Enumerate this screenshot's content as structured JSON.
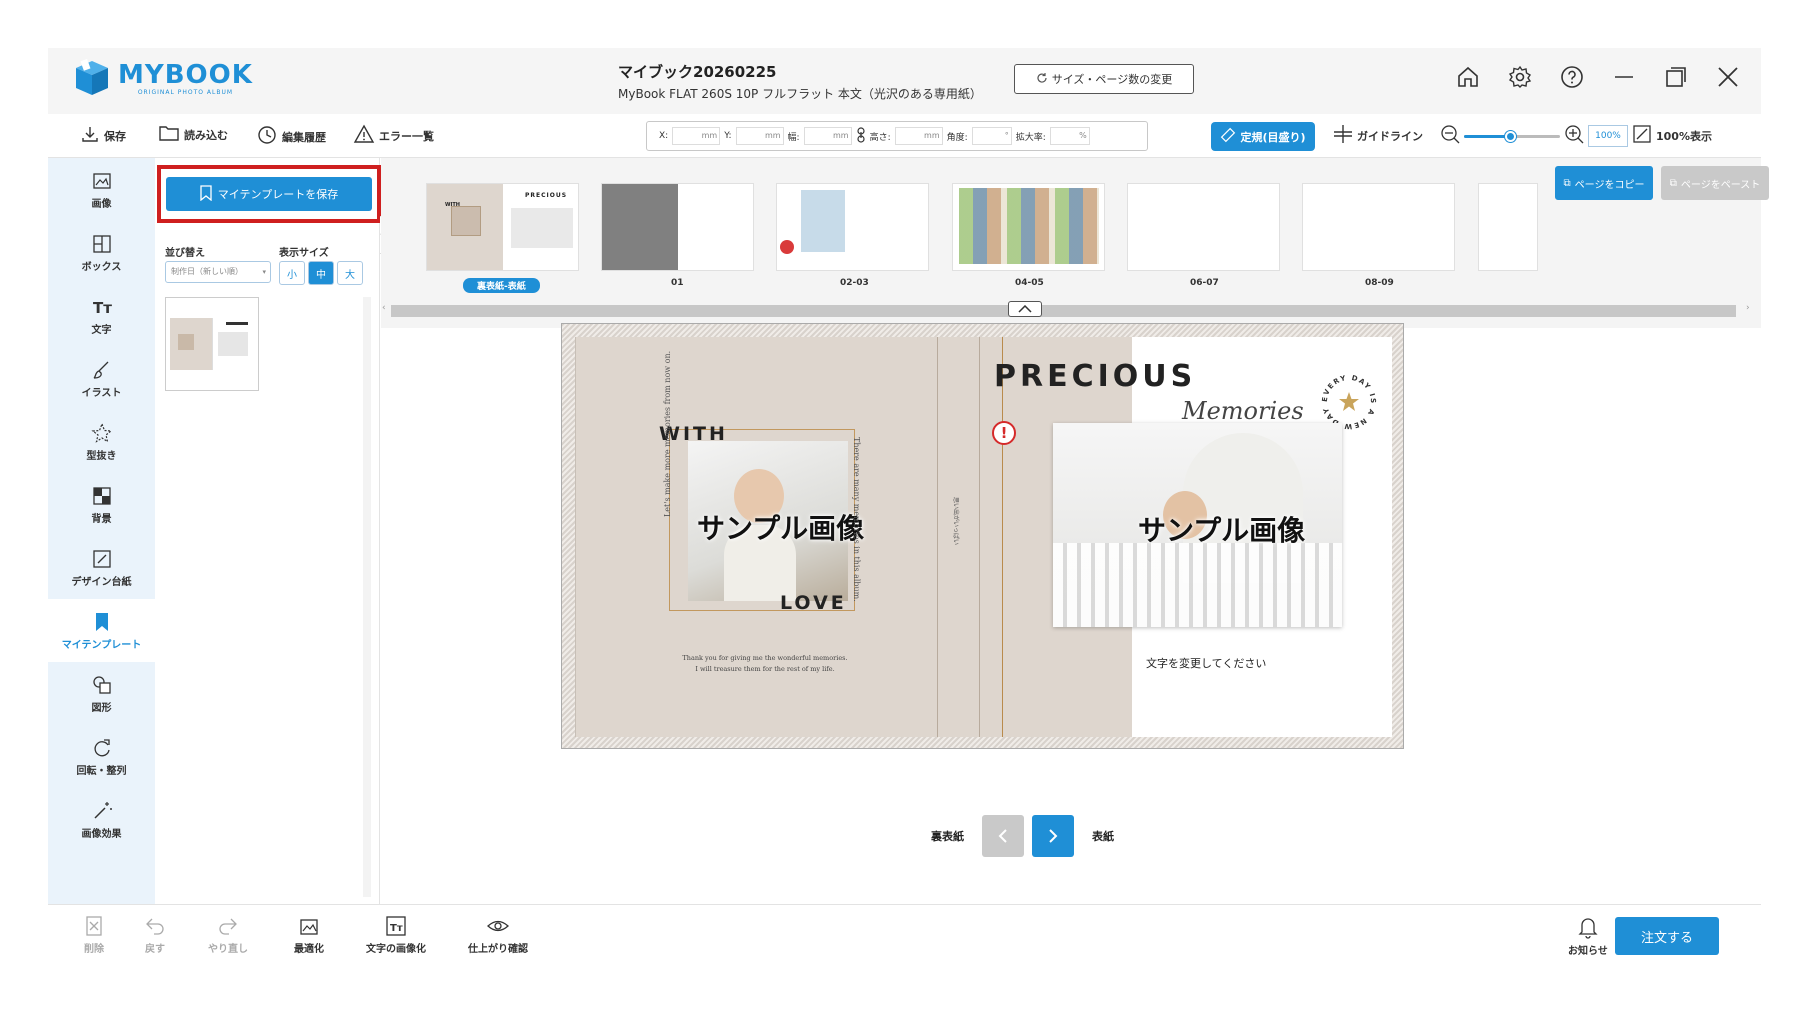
{
  "app": {
    "logo_text": "MYBOOK",
    "logo_sub": "ORIGINAL PHOTO ALBUM",
    "doc_title": "マイブック20260225",
    "doc_subtitle": "MyBook FLAT 260S 10P フルフラット 本文（光沢のある専用紙）",
    "size_change_label": "サイズ・ページ数の変更"
  },
  "window_icons": [
    "home-icon",
    "gear-icon",
    "help-icon",
    "minimize-icon",
    "restore-icon",
    "close-icon"
  ],
  "toolbar": {
    "save_label": "保存",
    "load_label": "読み込む",
    "history_label": "編集履歴",
    "errors_label": "エラー一覧",
    "x_label": "X:",
    "y_label": "Y:",
    "width_label": "幅:",
    "height_label": "高さ:",
    "angle_label": "角度:",
    "zoom_label": "拡大率:",
    "mm_unit": "mm",
    "deg_unit": "°",
    "pct_unit": "%",
    "ruler_label": "定規(目盛り)",
    "guideline_label": "ガイドライン",
    "zoom_value": "100%",
    "zoom_slider_value": 0.5,
    "fit_label": "100%表示"
  },
  "sidebar": {
    "items": [
      {
        "label": "画像",
        "icon": "image-icon"
      },
      {
        "label": "ボックス",
        "icon": "box-icon"
      },
      {
        "label": "文字",
        "icon": "text-icon"
      },
      {
        "label": "イラスト",
        "icon": "brush-icon"
      },
      {
        "label": "型抜き",
        "icon": "star-cutout-icon"
      },
      {
        "label": "背景",
        "icon": "background-icon"
      },
      {
        "label": "デザイン台紙",
        "icon": "design-mount-icon"
      },
      {
        "label": "マイテンプレート",
        "icon": "bookmark-icon",
        "active": true
      },
      {
        "label": "図形",
        "icon": "shape-icon"
      },
      {
        "label": "回転・整列",
        "icon": "rotate-icon"
      },
      {
        "label": "画像効果",
        "icon": "magic-wand-icon"
      }
    ]
  },
  "panel": {
    "save_template_label": "マイテンプレートを保存",
    "sort_label": "並び替え",
    "sort_value": "制作日（新しい順）",
    "display_size_label": "表示サイズ",
    "sizes": [
      "小",
      "中",
      "大"
    ],
    "selected_size": "中"
  },
  "strip": {
    "pages": [
      "裏表紙-表紙",
      "01",
      "02-03",
      "04-05",
      "06-07",
      "08-09"
    ],
    "selected": "裏表紙-表紙",
    "copy_label": "ページをコピー",
    "paste_label": "ページをペースト"
  },
  "spread": {
    "with_text": "WITH",
    "love_text": "LOVE",
    "precious_text": "PRECIOUS",
    "memories_text": "Memories",
    "badge_text": "EVERY DAY IS A NEW DAY",
    "sample_label": "サンプル画像",
    "vertical_left": "Let's make more memories from now on.",
    "vertical_right": "There are many memories in this album.",
    "spine_text": "思い出がいっぱい",
    "thanks_line1": "Thank you for giving me the wonderful memories.",
    "thanks_line2": "I will treasure them for the rest of my life.",
    "edit_text": "文字を変更してください"
  },
  "nav": {
    "back_label": "裏表紙",
    "front_label": "表紙"
  },
  "bottombar": {
    "delete_label": "削除",
    "undo_label": "戻す",
    "redo_label": "やり直し",
    "optimize_label": "最適化",
    "text_to_image_label": "文字の画像化",
    "preview_label": "仕上がり確認",
    "notice_label": "お知らせ",
    "order_label": "注文する"
  },
  "colors": {
    "accent": "#1f8fd6",
    "highlight_frame": "#cf1f1f",
    "cover_beige": "#ded6ce"
  }
}
